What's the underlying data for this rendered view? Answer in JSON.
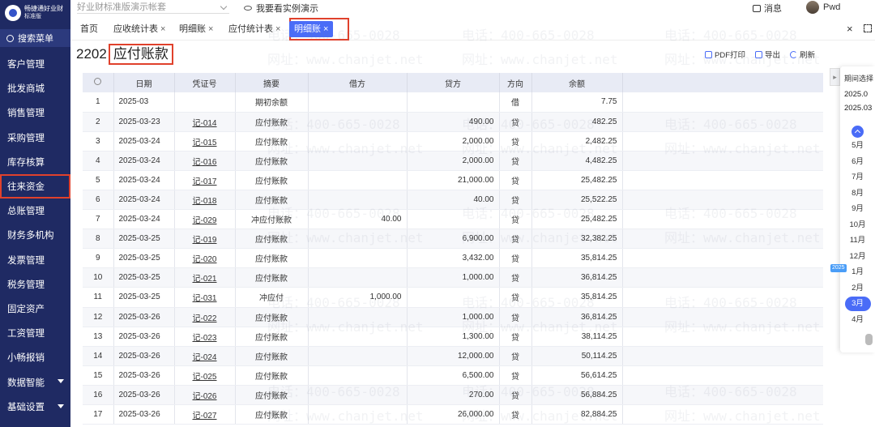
{
  "brand": {
    "name": "畅捷通好业财",
    "edition": "标准版"
  },
  "sidebar": {
    "search_label": "搜索菜单",
    "items": [
      {
        "label": "客户管理"
      },
      {
        "label": "批发商城"
      },
      {
        "label": "销售管理"
      },
      {
        "label": "采购管理"
      },
      {
        "label": "库存核算"
      },
      {
        "label": "往来资金"
      },
      {
        "label": "总账管理"
      },
      {
        "label": "财务多机构"
      },
      {
        "label": "发票管理"
      },
      {
        "label": "税务管理"
      },
      {
        "label": "固定资产"
      },
      {
        "label": "工资管理"
      },
      {
        "label": "小畅报销"
      },
      {
        "label": "数据智能"
      },
      {
        "label": "基础设置"
      }
    ]
  },
  "topbar": {
    "book_value": "好业财标准版演示帐套",
    "demo_label": "我要看实例演示",
    "messages_label": "消息",
    "user_name": "Pwd"
  },
  "tabs": [
    {
      "label": "首页"
    },
    {
      "label": "应收统计表"
    },
    {
      "label": "明细账"
    },
    {
      "label": "应付统计表"
    },
    {
      "label": "明细账"
    }
  ],
  "tab_close_glyph": "×",
  "page": {
    "code": "2202",
    "title": "应付账款"
  },
  "actions": {
    "pdf": "PDF打印",
    "export": "导出",
    "refresh": "刷新"
  },
  "table": {
    "headers": [
      "日期",
      "凭证号",
      "摘要",
      "借方",
      "贷方",
      "方向",
      "余额"
    ],
    "rows": [
      [
        "1",
        "2025-03",
        "",
        "期初余额",
        "",
        "",
        "借",
        "7.75"
      ],
      [
        "2",
        "2025-03-23",
        "记-014",
        "应付账款",
        "",
        "490.00",
        "贷",
        "482.25"
      ],
      [
        "3",
        "2025-03-24",
        "记-015",
        "应付账款",
        "",
        "2,000.00",
        "贷",
        "2,482.25"
      ],
      [
        "4",
        "2025-03-24",
        "记-016",
        "应付账款",
        "",
        "2,000.00",
        "贷",
        "4,482.25"
      ],
      [
        "5",
        "2025-03-24",
        "记-017",
        "应付账款",
        "",
        "21,000.00",
        "贷",
        "25,482.25"
      ],
      [
        "6",
        "2025-03-24",
        "记-018",
        "应付账款",
        "",
        "40.00",
        "贷",
        "25,522.25"
      ],
      [
        "7",
        "2025-03-24",
        "记-029",
        "冲应付账款",
        "40.00",
        "",
        "贷",
        "25,482.25"
      ],
      [
        "8",
        "2025-03-25",
        "记-019",
        "应付账款",
        "",
        "6,900.00",
        "贷",
        "32,382.25"
      ],
      [
        "9",
        "2025-03-25",
        "记-020",
        "应付账款",
        "",
        "3,432.00",
        "贷",
        "35,814.25"
      ],
      [
        "10",
        "2025-03-25",
        "记-021",
        "应付账款",
        "",
        "1,000.00",
        "贷",
        "36,814.25"
      ],
      [
        "11",
        "2025-03-25",
        "记-031",
        "冲应付",
        "1,000.00",
        "",
        "贷",
        "35,814.25"
      ],
      [
        "12",
        "2025-03-26",
        "记-022",
        "应付账款",
        "",
        "1,000.00",
        "贷",
        "36,814.25"
      ],
      [
        "13",
        "2025-03-26",
        "记-023",
        "应付账款",
        "",
        "1,300.00",
        "贷",
        "38,114.25"
      ],
      [
        "14",
        "2025-03-26",
        "记-024",
        "应付账款",
        "",
        "12,000.00",
        "贷",
        "50,114.25"
      ],
      [
        "15",
        "2025-03-26",
        "记-025",
        "应付账款",
        "",
        "6,500.00",
        "贷",
        "56,614.25"
      ],
      [
        "16",
        "2025-03-26",
        "记-026",
        "应付账款",
        "",
        "270.00",
        "贷",
        "56,884.25"
      ],
      [
        "17",
        "2025-03-26",
        "记-027",
        "应付账款",
        "",
        "26,000.00",
        "贷",
        "82,884.25"
      ]
    ]
  },
  "period_panel": {
    "title": "期间选择",
    "range_start": "2025.0",
    "range_end": "2025.03",
    "year_badge": "2025",
    "months": [
      "5月",
      "6月",
      "7月",
      "8月",
      "9月",
      "10月",
      "11月",
      "12月",
      "1月",
      "2月",
      "3月",
      "4月"
    ],
    "selected_month": "3月"
  },
  "watermark": {
    "phone": "电话：400-665-0028",
    "site": "网址：www.chanjet.net"
  },
  "colors": {
    "sidebar": "#1f2a63",
    "accent": "#4a6cf7",
    "highlight_box": "#e0412c"
  }
}
